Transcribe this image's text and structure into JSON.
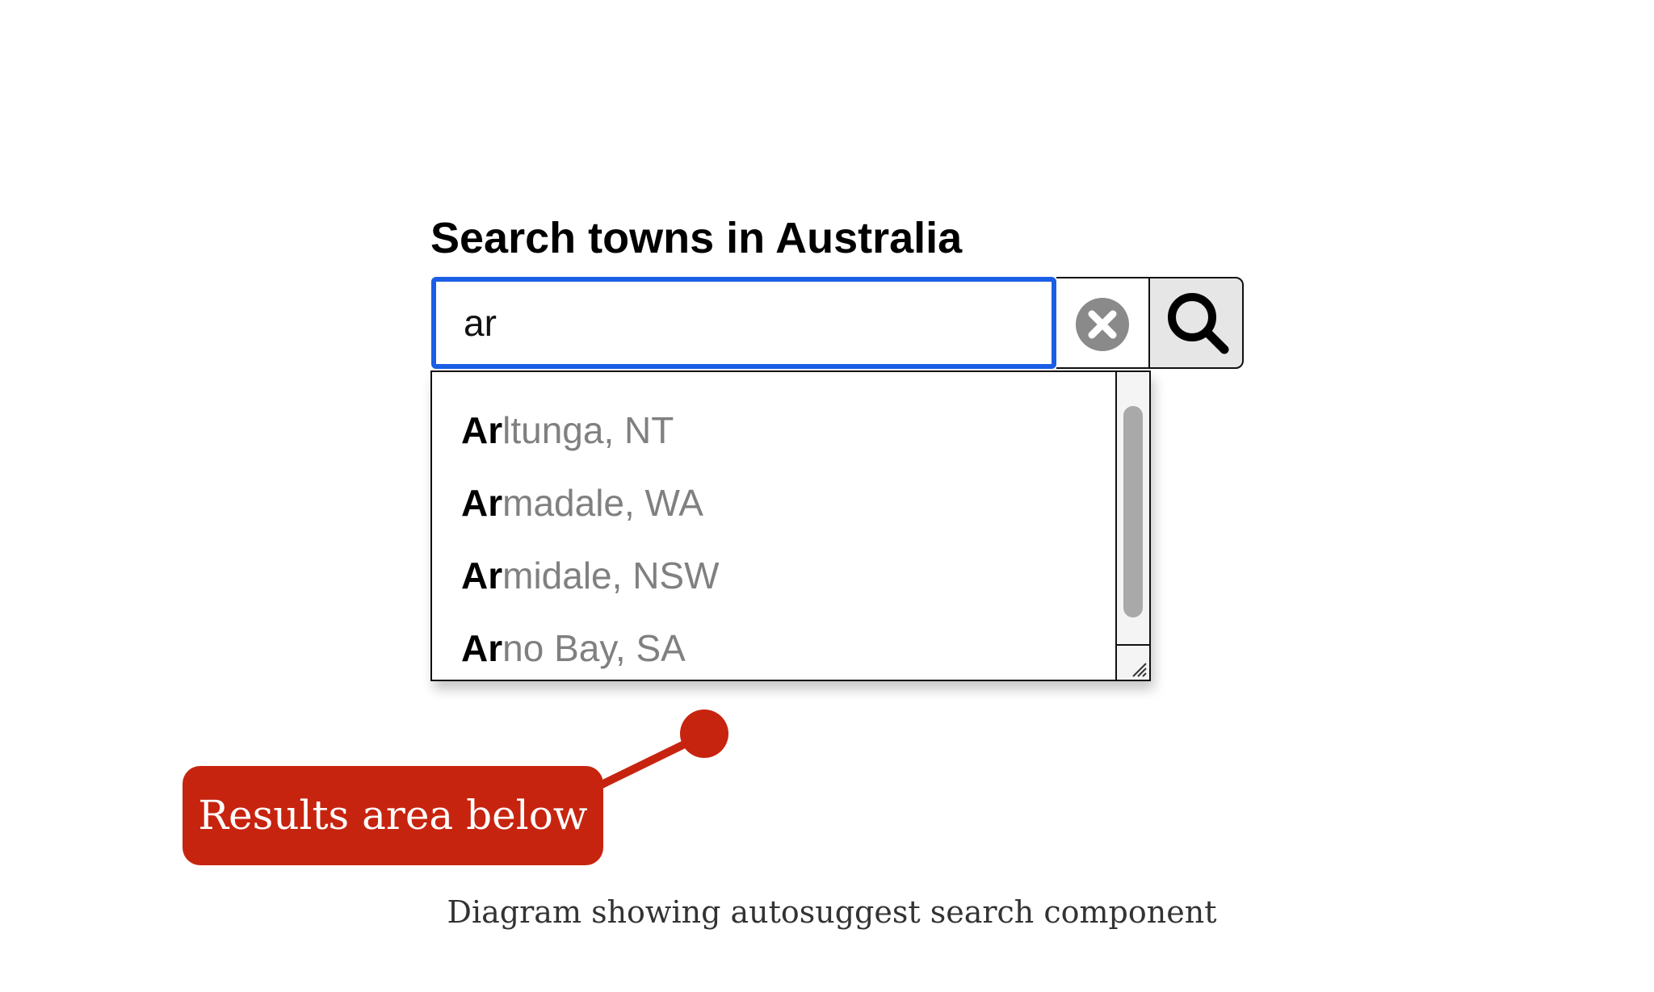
{
  "search": {
    "label": "Search towns in Australia",
    "input_value": "ar",
    "clear_icon": "clear-circle-x-icon",
    "submit_icon": "magnifying-glass-icon"
  },
  "results": {
    "items": [
      {
        "match": "Ar",
        "rest": "ltunga, NT"
      },
      {
        "match": "Ar",
        "rest": "madale, WA"
      },
      {
        "match": "Ar",
        "rest": "midale, NSW"
      },
      {
        "match": "Ar",
        "rest": "no Bay, SA"
      }
    ]
  },
  "callout": {
    "label": "Results area below",
    "color": "#c7240f"
  },
  "caption": "Diagram showing autosuggest search component",
  "colors": {
    "focus_border": "#1a5ee6",
    "match_text": "#000000",
    "suggestion_text": "#808080",
    "search_button_bg": "#e6e6e6"
  }
}
